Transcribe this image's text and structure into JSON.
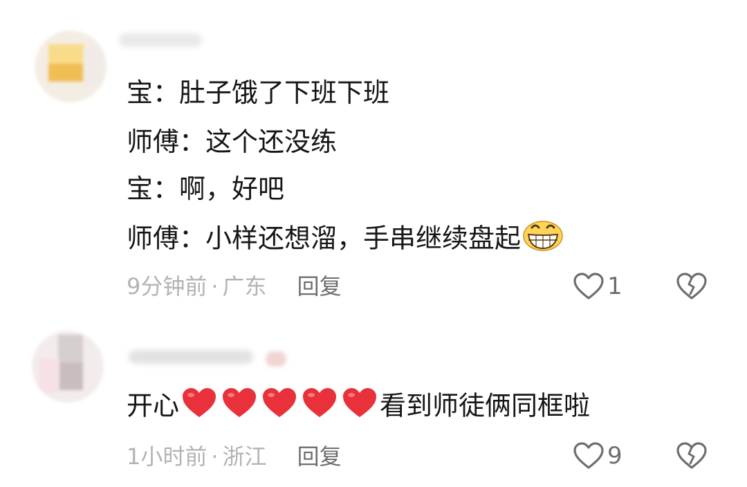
{
  "comments": [
    {
      "lines": [
        "宝：肚子饿了下班下班",
        "师傅：这个还没练",
        "宝：啊，好吧",
        "师傅：小样还想溜，手串继续盘起"
      ],
      "trailing_emoji": "grinning-face",
      "time": "9分钟前",
      "location": "广东",
      "reply_label": "回复",
      "like_count": "1"
    },
    {
      "text_before": "开心",
      "heart_count": 5,
      "text_after": "看到师徒俩同框啦",
      "time": "1小时前",
      "location": "浙江",
      "reply_label": "回复",
      "like_count": "9"
    }
  ],
  "separator": "·",
  "icons": {
    "like": "heart-outline-icon",
    "dislike": "broken-heart-icon",
    "heart_emoji": "red-heart-emoji",
    "grin_emoji": "grinning-face-emoji"
  },
  "colors": {
    "text": "#161616",
    "meta": "#b3b3b3",
    "action": "#6d6d6d",
    "heart": "#e8313a"
  }
}
